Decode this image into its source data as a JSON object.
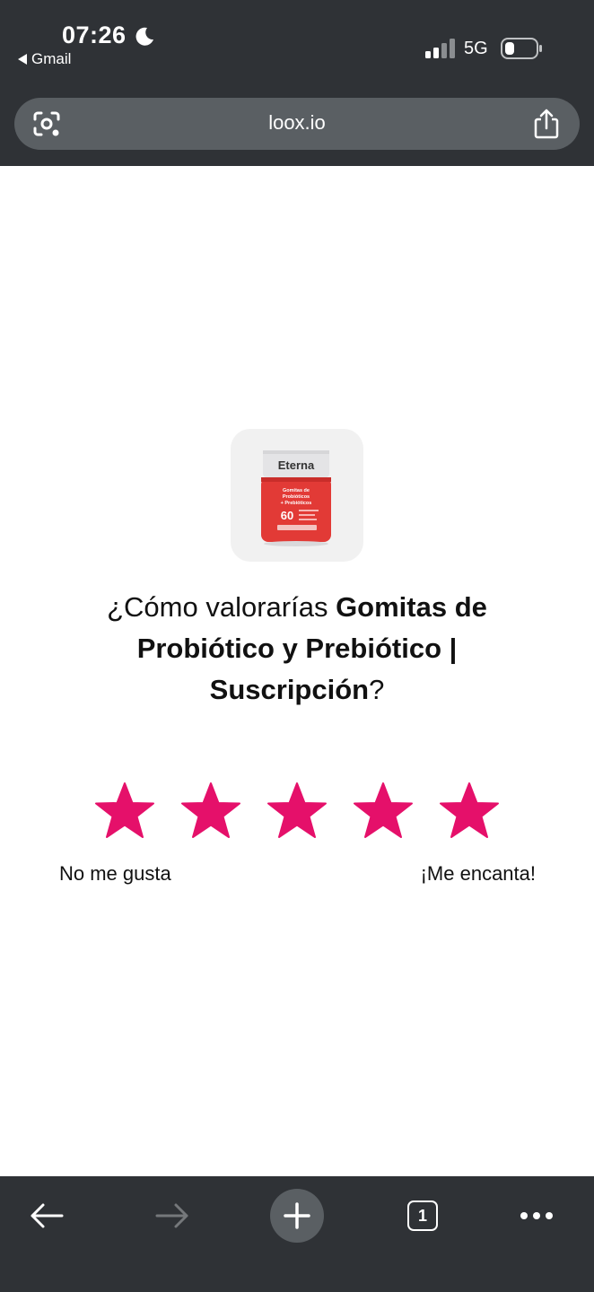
{
  "status_bar": {
    "time": "07:26",
    "back_app": "Gmail",
    "network": "5G"
  },
  "browser": {
    "url": "loox.io",
    "tab_count": "1"
  },
  "product": {
    "brand": "Eterna",
    "label_line1": "Gomitas de",
    "label_line2": "Probióticos",
    "label_line3": "+ Prebióticos",
    "count": "60"
  },
  "rating": {
    "question_prefix": "¿Cómo valorarías ",
    "product_name": "Gomitas de Probiótico y Prebiótico | Suscripción",
    "question_suffix": "?",
    "star_count": 5,
    "low_label": "No me gusta",
    "high_label": "¡Me encanta!"
  },
  "colors": {
    "star": "#e5106a",
    "chrome": "#2f3236",
    "pill": "#5a5f63",
    "bottle": "#e23a36"
  }
}
